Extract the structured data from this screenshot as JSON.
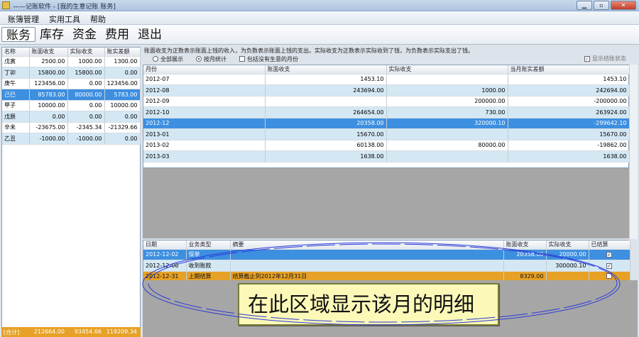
{
  "window": {
    "title": "——记账软件 - [我的生意记账 账务]"
  },
  "menu": [
    "账簿管理",
    "实用工具",
    "帮助"
  ],
  "toolbar": [
    "账务",
    "库存",
    "资金",
    "费用",
    "退出"
  ],
  "left": {
    "columns": [
      "名称",
      "账面收支",
      "实际收支",
      "账实差额"
    ],
    "rows": [
      [
        "戊寅",
        "2500.00",
        "1000.00",
        "1300.00"
      ],
      [
        "丁卯",
        "15800.00",
        "15800.00",
        "0.00"
      ],
      [
        "庚午",
        "123456.00",
        "0.00",
        "123456.00"
      ],
      [
        "己巳",
        "85783.00",
        "80000.00",
        "5783.00"
      ],
      [
        "甲子",
        "10000.00",
        "0.00",
        "10000.00"
      ],
      [
        "戊辰",
        "0.00",
        "0.00",
        "0.00"
      ],
      [
        "辛未",
        "-23675.00",
        "-2345.34",
        "-21329.66"
      ],
      [
        "乙丑",
        "-1000.00",
        "-1000.00",
        "0.00"
      ]
    ],
    "total": [
      "[合计]",
      "212664.00",
      "93454.66",
      "119209.34"
    ]
  },
  "info": "账面收支为正数表示账面上钱的收入，为负数表示账面上钱的支出。实际收支为正数表示实际收到了钱，为负数表示实际支出了钱。",
  "options": {
    "all": "全部展示",
    "monthly": "按月统计",
    "include": "包括没有生意的月份",
    "show_state": "显示结账状态"
  },
  "monthly": {
    "columns": [
      "月份",
      "账面收支",
      "实际收支",
      "当月账实差额"
    ],
    "rows": [
      [
        "2012-07",
        "1453.10",
        "",
        "1453.10"
      ],
      [
        "2012-08",
        "243694.00",
        "1000.00",
        "242694.00"
      ],
      [
        "2012-09",
        "",
        "200000.00",
        "-200000.00"
      ],
      [
        "2012-10",
        "264654.00",
        "730.00",
        "263924.00"
      ],
      [
        "2012-12",
        "20358.00",
        "320000.10",
        "-299642.10"
      ],
      [
        "2013-01",
        "15670.00",
        "",
        "15670.00"
      ],
      [
        "2013-02",
        "60138.00",
        "80000.00",
        "-19862.00"
      ],
      [
        "2013-03",
        "1638.00",
        "",
        "1638.00"
      ]
    ]
  },
  "detail": {
    "columns": [
      "日期",
      "业务类型",
      "摘要",
      "账面收支",
      "实际收支",
      "已结算"
    ],
    "rows": [
      [
        "2012-12-02",
        "保单",
        "",
        "20358.00",
        "20000.00",
        "✓"
      ],
      [
        "2012-12-06",
        "收到账款",
        "",
        "",
        "300000.10",
        "✓"
      ],
      [
        "2012-12-31",
        "上期结算",
        "结算截止到2012年12月31日",
        "8329.00",
        "",
        ""
      ]
    ]
  },
  "callout": "在此区域显示该月的明细"
}
